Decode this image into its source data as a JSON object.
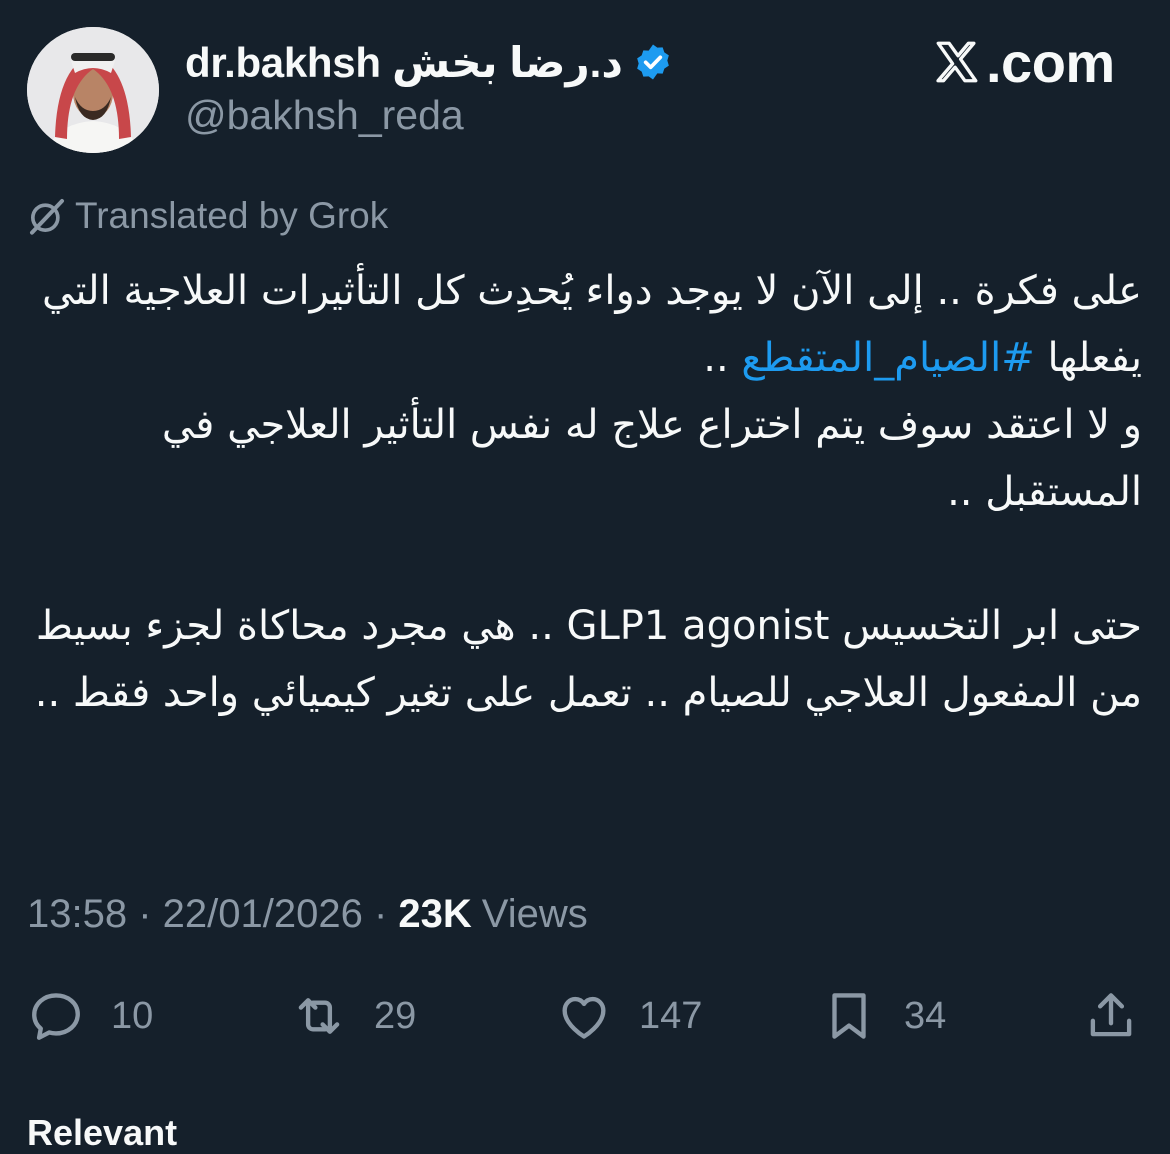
{
  "author": {
    "display_name": "dr.bakhsh د.رضا بخش",
    "handle": "@bakhsh_reda",
    "verified": true
  },
  "brand": {
    "text": ".com"
  },
  "translation": {
    "label": "Translated by Grok"
  },
  "tweet": {
    "p1_a": "على فكرة .. إلى الآن لا يوجد دواء يُحدِث كل التأثيرات العلاجية التي يفعلها",
    "p1_hashtag": "#الصيام_المتقطع",
    "p1_b": "..",
    "p2": "و لا اعتقد سوف يتم اختراع علاج له نفس التأثير العلاجي في المستقبل ..",
    "p3_a": "حتى ابر التخسيس",
    "p3_term": "GLP1 agonist",
    "p3_b": ".. هي مجرد محاكاة لجزء بسيط من المفعول العلاجي للصيام .. تعمل على تغير كيميائي واحد فقط .."
  },
  "meta": {
    "time": "13:58",
    "separator": " · ",
    "date": "22/01/2026",
    "views_count": "23K",
    "views_label": "Views"
  },
  "actions": {
    "replies": "10",
    "reposts": "29",
    "likes": "147",
    "bookmarks": "34"
  },
  "footer": {
    "label": "Relevant"
  },
  "colors": {
    "background": "#15202b",
    "text": "#f7f9f9",
    "secondary": "#8b98a5",
    "accent": "#1d9bf0"
  }
}
